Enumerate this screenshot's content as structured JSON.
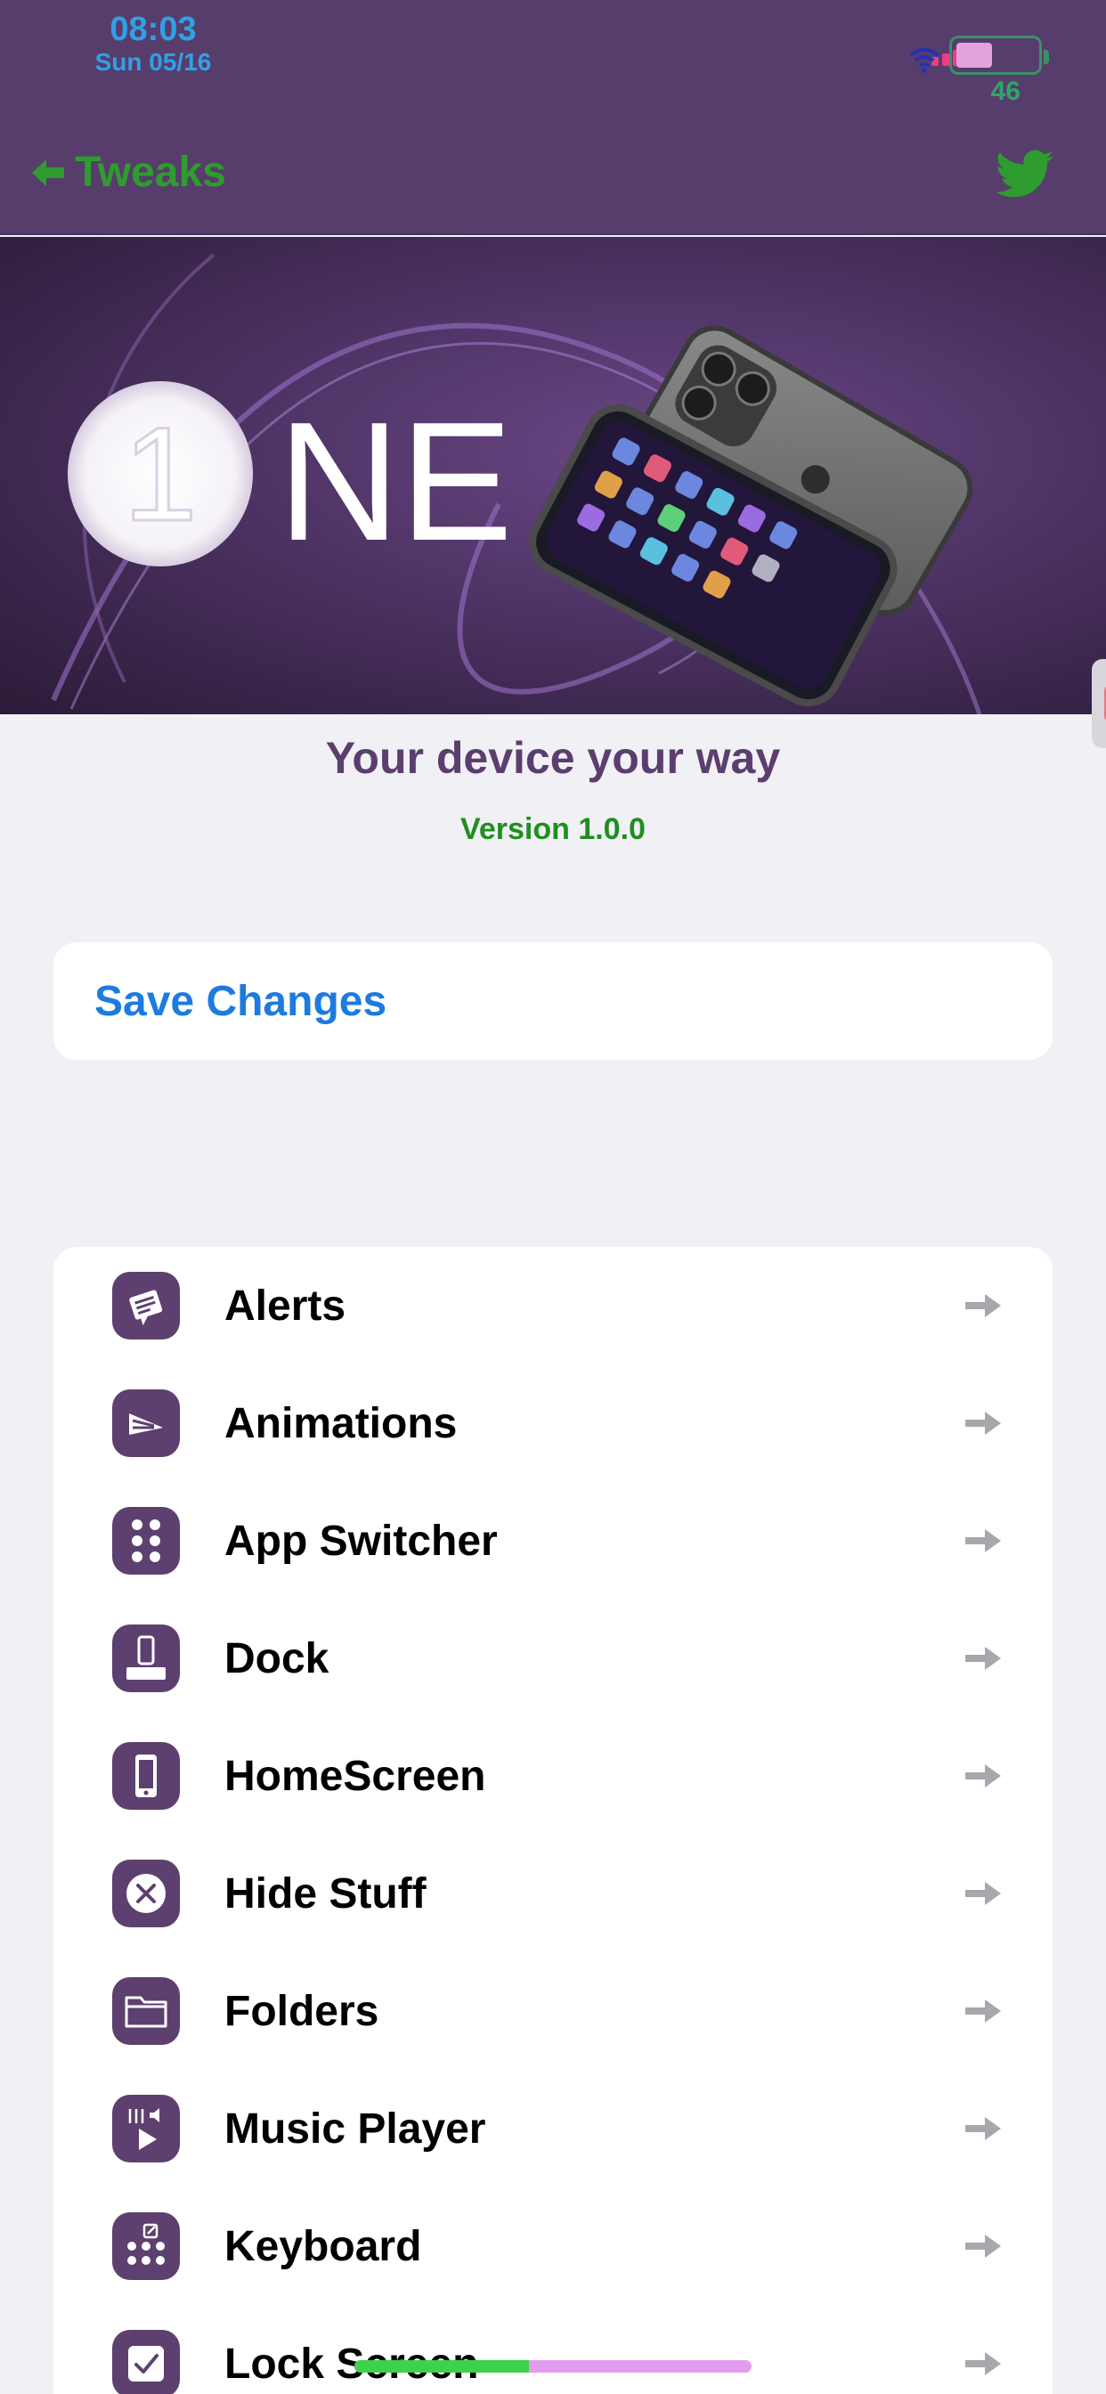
{
  "status_bar": {
    "time": "08:03",
    "date": "Sun 05/16",
    "battery_percent": "46",
    "battery_level": 0.46
  },
  "nav": {
    "back_label": "Tweaks",
    "back_icon": "arrow-left-icon",
    "share_icon": "twitter-icon"
  },
  "banner": {
    "logo_text": "1NE",
    "logo_lettering": "NE"
  },
  "tagline": "Your device your way",
  "version": "Version 1.0.0",
  "save_button": "Save Changes",
  "menu": [
    {
      "label": "Alerts",
      "icon": "alert-icon"
    },
    {
      "label": "Animations",
      "icon": "animation-icon"
    },
    {
      "label": "App Switcher",
      "icon": "app-switcher-icon"
    },
    {
      "label": "Dock",
      "icon": "dock-icon"
    },
    {
      "label": "HomeScreen",
      "icon": "homescreen-icon"
    },
    {
      "label": "Hide Stuff",
      "icon": "hide-icon"
    },
    {
      "label": "Folders",
      "icon": "folder-icon"
    },
    {
      "label": "Music Player",
      "icon": "music-player-icon"
    },
    {
      "label": "Keyboard",
      "icon": "keyboard-icon"
    },
    {
      "label": "Lock Screen",
      "icon": "lock-screen-icon"
    }
  ],
  "home_indicator_progress": 0.44,
  "colors": {
    "header": "#573d6b",
    "accent_green": "#2e9c2e",
    "link_blue": "#1d7be0",
    "icon_tile": "#5d406f"
  }
}
